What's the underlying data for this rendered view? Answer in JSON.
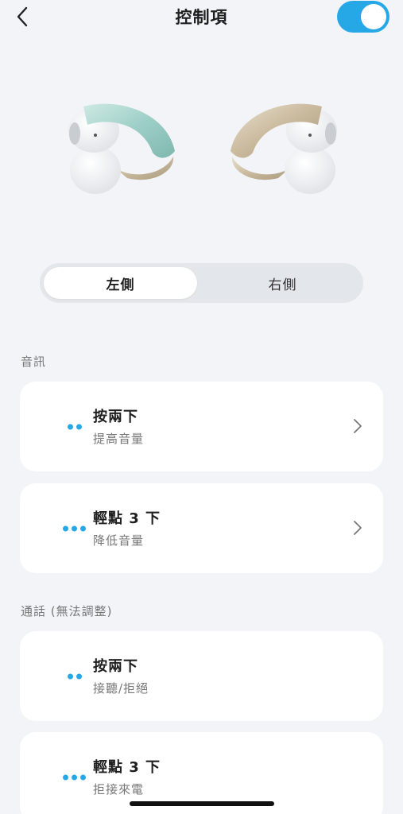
{
  "header": {
    "title": "控制項",
    "toggle_on": true
  },
  "segment": {
    "left_label": "左側",
    "right_label": "右側",
    "selected": "左側"
  },
  "sections": [
    {
      "label": "音訊",
      "items": [
        {
          "dots": 2,
          "title": "按兩下",
          "subtitle": "提高音量"
        },
        {
          "dots": 3,
          "title": "輕點 3 下",
          "subtitle": "降低音量"
        }
      ]
    },
    {
      "label": "通話 (無法調整)",
      "items": [
        {
          "dots": 2,
          "title": "按兩下",
          "subtitle": "接聽/拒絕"
        },
        {
          "dots": 3,
          "title": "輕點 3 下",
          "subtitle": "拒接來電"
        }
      ]
    }
  ],
  "colors": {
    "accent": "#27a8e6",
    "background": "#f2f4f7",
    "card": "#ffffff"
  }
}
